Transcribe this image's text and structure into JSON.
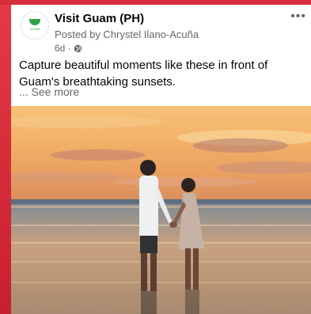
{
  "post": {
    "page_name": "Visit Guam (PH)",
    "posted_by": "Posted by Chrystel Ilano-Acuña",
    "time": "6d ·",
    "body_text": "Capture beautiful moments like these in front of Guam's breathtaking sunsets.",
    "see_more": "... See more",
    "avatar_logo_text": "GUAM",
    "more_icon": "ellipsis-icon",
    "privacy_icon": "globe-icon"
  },
  "colors": {
    "brand_green": "#2fa34a",
    "background_red": "#d62a3a"
  }
}
